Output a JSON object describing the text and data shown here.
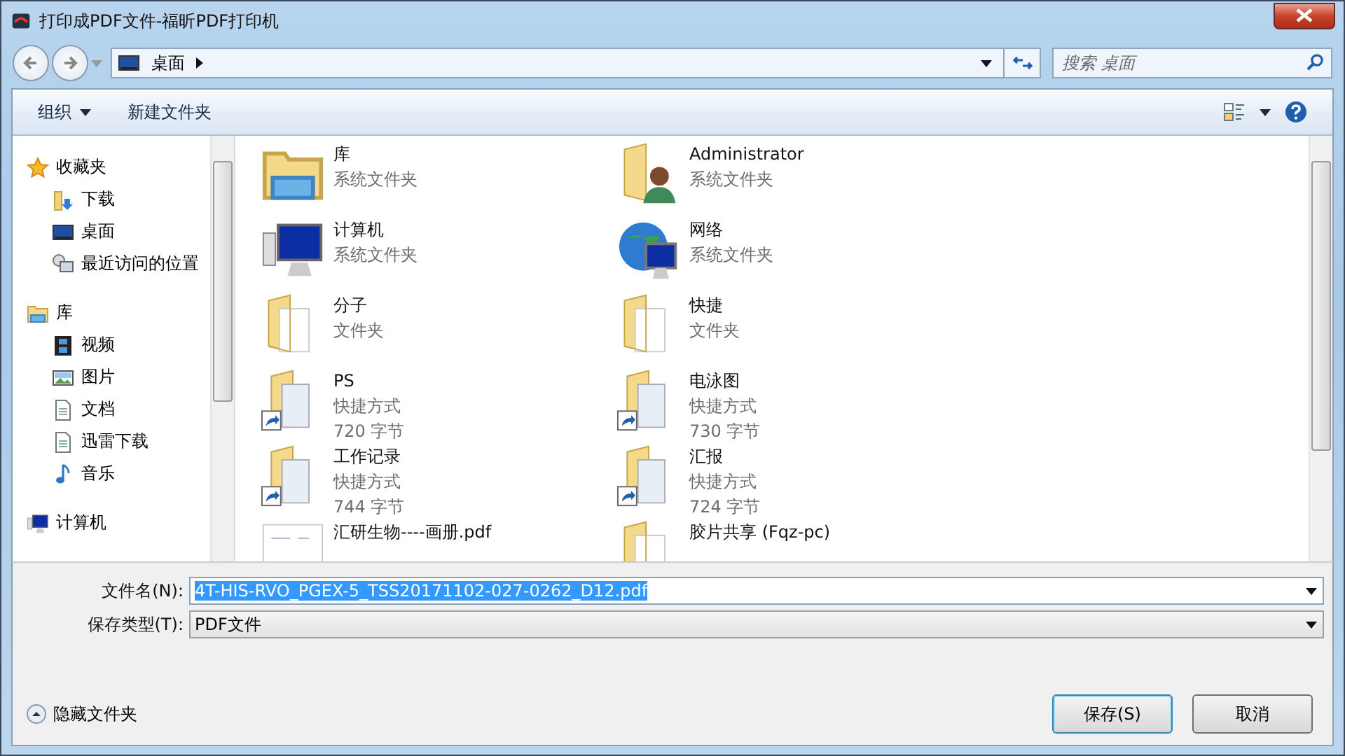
{
  "window": {
    "title": "打印成PDF文件-福昕PDF打印机"
  },
  "address": {
    "location": "桌面"
  },
  "search": {
    "placeholder": "搜索 桌面"
  },
  "toolbar": {
    "organize": "组织",
    "new_folder": "新建文件夹"
  },
  "sidebar": {
    "groups": [
      {
        "label": "收藏夹",
        "kind": "star",
        "items": [
          {
            "label": "下载",
            "kind": "download"
          },
          {
            "label": "桌面",
            "kind": "desktop"
          },
          {
            "label": "最近访问的位置",
            "kind": "recent"
          }
        ]
      },
      {
        "label": "库",
        "kind": "library",
        "items": [
          {
            "label": "视频",
            "kind": "video"
          },
          {
            "label": "图片",
            "kind": "picture"
          },
          {
            "label": "文档",
            "kind": "document"
          },
          {
            "label": "迅雷下载",
            "kind": "document"
          },
          {
            "label": "音乐",
            "kind": "music"
          }
        ]
      },
      {
        "label": "计算机",
        "kind": "computer"
      }
    ]
  },
  "files": [
    {
      "name": "库",
      "type": "系统文件夹",
      "kind": "library"
    },
    {
      "name": "Administrator",
      "type": "系统文件夹",
      "kind": "user"
    },
    {
      "name": "计算机",
      "type": "系统文件夹",
      "kind": "computer"
    },
    {
      "name": "网络",
      "type": "系统文件夹",
      "kind": "network"
    },
    {
      "name": "分子",
      "type": "文件夹",
      "kind": "folder"
    },
    {
      "name": "快捷",
      "type": "文件夹",
      "kind": "folder"
    },
    {
      "name": "PS",
      "type": "快捷方式",
      "size": "720 字节",
      "kind": "shortcut"
    },
    {
      "name": "电泳图",
      "type": "快捷方式",
      "size": "730 字节",
      "kind": "shortcut"
    },
    {
      "name": "工作记录",
      "type": "快捷方式",
      "size": "744 字节",
      "kind": "shortcut"
    },
    {
      "name": "汇报",
      "type": "快捷方式",
      "size": "724 字节",
      "kind": "shortcut"
    },
    {
      "name": "汇研生物----画册.pdf",
      "kind": "pdf"
    },
    {
      "name": "胶片共享 (Fqz-pc)",
      "kind": "folder"
    }
  ],
  "form": {
    "filename_label": "文件名(N):",
    "filename": "4T-HIS-RVO_PGEX-5_TSS20171102-027-0262_D12.pdf",
    "filename_selected": true,
    "filetype_label": "保存类型(T):",
    "filetype": "PDF文件"
  },
  "hide_folders": "隐藏文件夹",
  "buttons": [
    {
      "label": "保存(S)",
      "default": true
    },
    {
      "label": "取消",
      "default": false
    }
  ]
}
